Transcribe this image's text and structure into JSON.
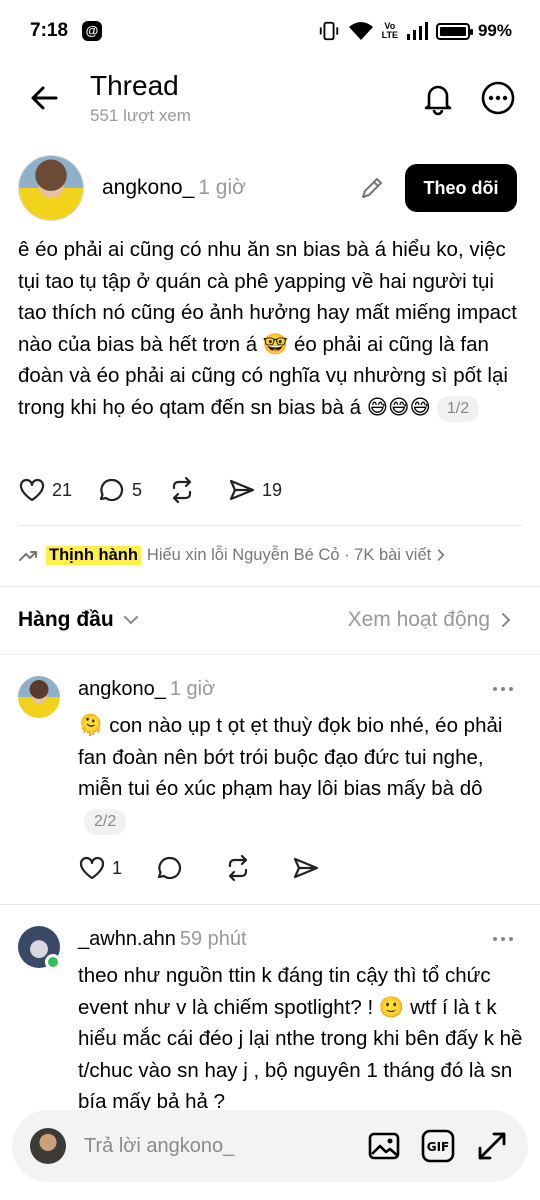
{
  "status_bar": {
    "time": "7:18",
    "battery_pct": "99%",
    "volte_top": "Vo",
    "volte_bottom": "LTE"
  },
  "header": {
    "title": "Thread",
    "views": "551 lượt xem"
  },
  "post": {
    "author": "angkono_",
    "time": "1 giờ",
    "follow_label": "Theo dõi",
    "text": "ê éo phải ai cũng có nhu ăn sn bias bà á hiểu ko, việc tụi tao tụ tập ở quán cà phê yapping về hai người tụi tao thích nó cũng éo ảnh hưởng hay mất miếng impact nào của bias bà hết trơn á 🤓 éo phải ai cũng là fan đoàn và éo phải ai cũng có nghĩa vụ nhường sì pốt lại trong khi họ éo qtam đến sn bias bà á 😅😅😅",
    "page": "1/2",
    "likes": "21",
    "comments": "5",
    "shares": "19"
  },
  "trending": {
    "label": "Thịnh hành",
    "topic": "Hiếu xin lỗi Nguyễn Bé Cỏ · 7K bài viết"
  },
  "sort": {
    "label": "Hàng đầu",
    "activity": "Xem hoạt động"
  },
  "replies": [
    {
      "author": "angkono_",
      "time": "1 giờ",
      "text": "🫠 con nào ụp t ọt ẹt thuỳ đọk bio  nhé, éo phải fan đoàn nên bớt trói buộc đạo đức tui nghe, miễn tui éo xúc phạm hay lôi bias mấy bà dô",
      "page": "2/2",
      "likes": "1"
    },
    {
      "author": "_awhn.ahn",
      "time": "59 phút",
      "text": "theo như nguồn ttin k đáng tin cậy thì tổ chức event như v là chiếm spotlight? ! 🙂 wtf í là t k hiểu mắc cái đéo j lại nthe trong khi bên đấy k hề t/chuc  vào sn hay j , bộ nguyên 1 tháng đó là sn bía mấy bả hả ?"
    }
  ],
  "reply_bar": {
    "placeholder": "Trả lời angkono_",
    "gif_label": "GIF"
  },
  "colors": {
    "trend_highlight": "#ffef4a",
    "online": "#2fc154",
    "muted": "#999999"
  }
}
